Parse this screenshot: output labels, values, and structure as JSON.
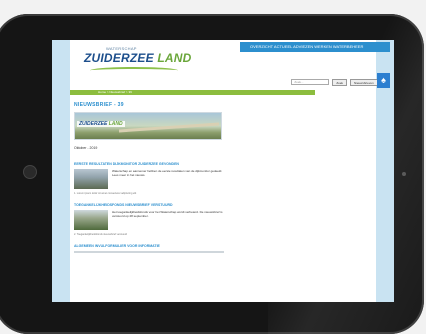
{
  "site": {
    "logo_small": "WATERSCHAP",
    "logo_main": "ZUIDERZEE",
    "logo_land": "LAND"
  },
  "topnav": {
    "text": "OVERZICHT   ACTUEEL   ADVIEZEN   WERKEN   WATERBEHEER"
  },
  "search": {
    "placeholder": "Zoek...",
    "button": "Zoek",
    "select": "Nieuwsbrieven"
  },
  "breadcrumb": {
    "text": "Home  >  Nieuwsbrief  >  39"
  },
  "newsletter": {
    "title": "NIEUWSBRIEF - 39",
    "edition": "Oktober - 2019"
  },
  "articles": [
    {
      "title": "EERSTE RESULTATEN DIJKMONITOR ZUIDERZEE GEVONDEN",
      "body": "Waterschap en aannemer hebben de eerste resultaten van de dijkmonitor gedeeld. Lees meer in het nieuws.",
      "caption": "1. Lorem ipsum dolor sit amet consectetur adipiscing elit"
    },
    {
      "title": "TOEGANKELIJKHEIDSFONDS NIEUWSBRIEF VERSTUURD",
      "body": "Het toegankelijkheidsfonds voor het Waterschap wordt verbeterd. De nieuwsbrief is verstuurd op 28 september.",
      "caption": "2. Toegankelijkheidsfonds nieuwsbrief verstuurd"
    },
    {
      "title": "ALGEMEEN INVULFORMULIER VOOR INFORMATIE",
      "body": "",
      "caption": ""
    }
  ],
  "colors": {
    "accent_blue": "#2c8fce",
    "accent_green": "#8cbd3e"
  }
}
